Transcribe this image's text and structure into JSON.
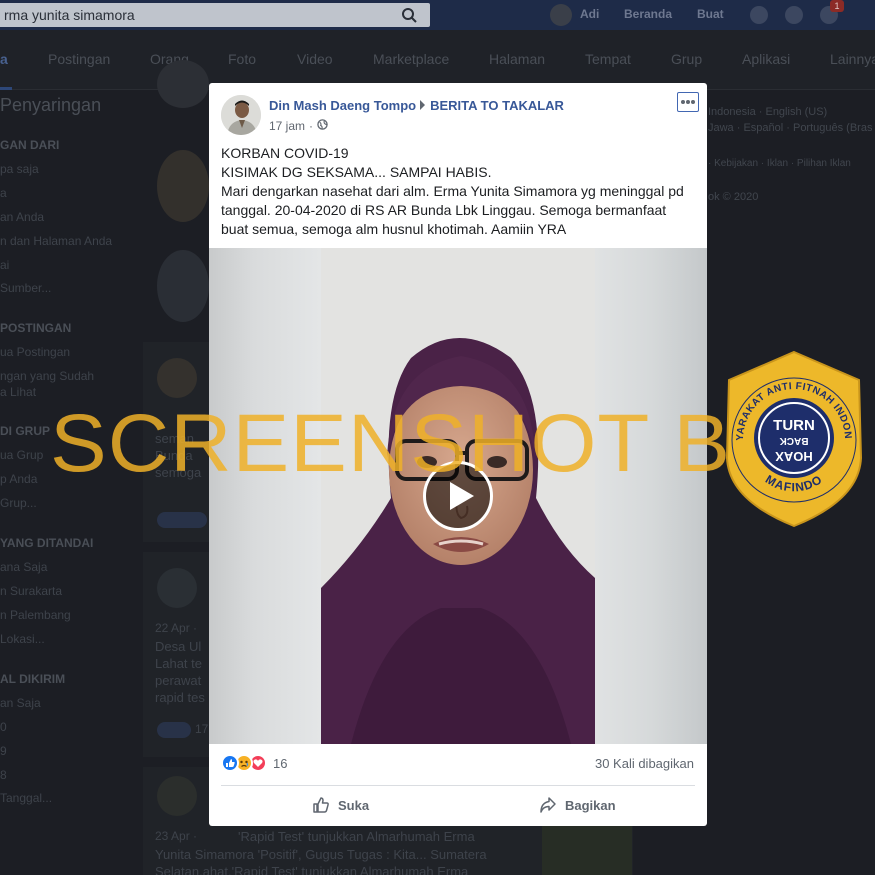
{
  "topbar": {
    "search_value": "rma yunita simamora",
    "user_name": "Adi",
    "home_label": "Beranda",
    "create_label": "Buat",
    "notification_count": "1"
  },
  "tabs": [
    {
      "label": "a"
    },
    {
      "label": "Postingan"
    },
    {
      "label": "Orang"
    },
    {
      "label": "Foto"
    },
    {
      "label": "Video"
    },
    {
      "label": "Marketplace"
    },
    {
      "label": "Halaman"
    },
    {
      "label": "Tempat"
    },
    {
      "label": "Grup"
    },
    {
      "label": "Aplikasi"
    },
    {
      "label": "Lainnya"
    }
  ],
  "sidebar": {
    "title": "Penyaringan",
    "sections": [
      {
        "heading": "GAN DARI",
        "items": [
          "pa saja",
          "a",
          "an Anda",
          "n dan Halaman Anda",
          "ai",
          "Sumber..."
        ]
      },
      {
        "heading": "POSTINGAN",
        "items": [
          "ua Postingan",
          "ngan yang Sudah",
          "a Lihat"
        ]
      },
      {
        "heading": "DI GRUP",
        "items": [
          "ua Grup",
          "p Anda",
          "Grup..."
        ]
      },
      {
        "heading": "YANG DITANDAI",
        "items": [
          "ana Saja",
          "n Surakarta",
          "n Palembang",
          "Lokasi..."
        ]
      },
      {
        "heading": "AL DIKIRIM",
        "items": [
          "an Saja",
          "0",
          "9",
          "8",
          "Tanggal..."
        ]
      }
    ]
  },
  "right_column": {
    "languages_1": "Indonesia · English (US)",
    "languages_2": "Jawa · Español · Português (Bras",
    "links": "· Kebijakan · Iklan · Pilihan Iklan",
    "copyright": "ok © 2020"
  },
  "background_feed": {
    "card1_lines": [
      "seman",
      "Bunda",
      "semoga"
    ],
    "card2_date": "22 Apr ·",
    "card2_lines": [
      "Desa Ul",
      "Lahat te",
      "perawat",
      "rapid tes"
    ],
    "card2_count": "17",
    "card3_date": "23 Apr ·",
    "card3_lines": [
      "'Rapid Test' tunjukkan Almarhumah Erma",
      "Yunita Simamora 'Positif', Gugus Tugas : Kita... Sumatera",
      "Selatan,ahat,'Rapid Test' tunjukkan Almarhumah Erma"
    ]
  },
  "watermark": {
    "text": "SCREENSHOT BY",
    "badge_top_text": "MASYARAKAT ANTI FITNAH INDONESIA",
    "badge_line1": "TURN",
    "badge_line2": "BACK",
    "badge_line3": "HOAX",
    "badge_bottom_text": "MAFINDO",
    "gold": "#ecb82a",
    "navy": "#1e2e6b"
  },
  "post": {
    "author": "Din Mash Daeng Tompo",
    "group": "BERITA TO TAKALAR",
    "time": "17 jam",
    "separator": "·",
    "privacy_icon": "globe-icon",
    "text_lines": [
      "KORBAN COVID-19",
      "KISIMAK DG SEKSAMA... SAMPAI HABIS.",
      "Mari dengarkan nasehat dari alm. Erma Yunita Simamora yg meninggal pd",
      "tanggal. 20-04-2020 di RS AR Bunda Lbk Linggau. Semoga bermanfaat",
      "buat semua, semoga alm husnul khotimah. Aamiin YRA"
    ],
    "reaction_count": "16",
    "share_count": "30 Kali dibagikan",
    "like_label": "Suka",
    "share_label": "Bagikan",
    "link_color": "#385898"
  }
}
